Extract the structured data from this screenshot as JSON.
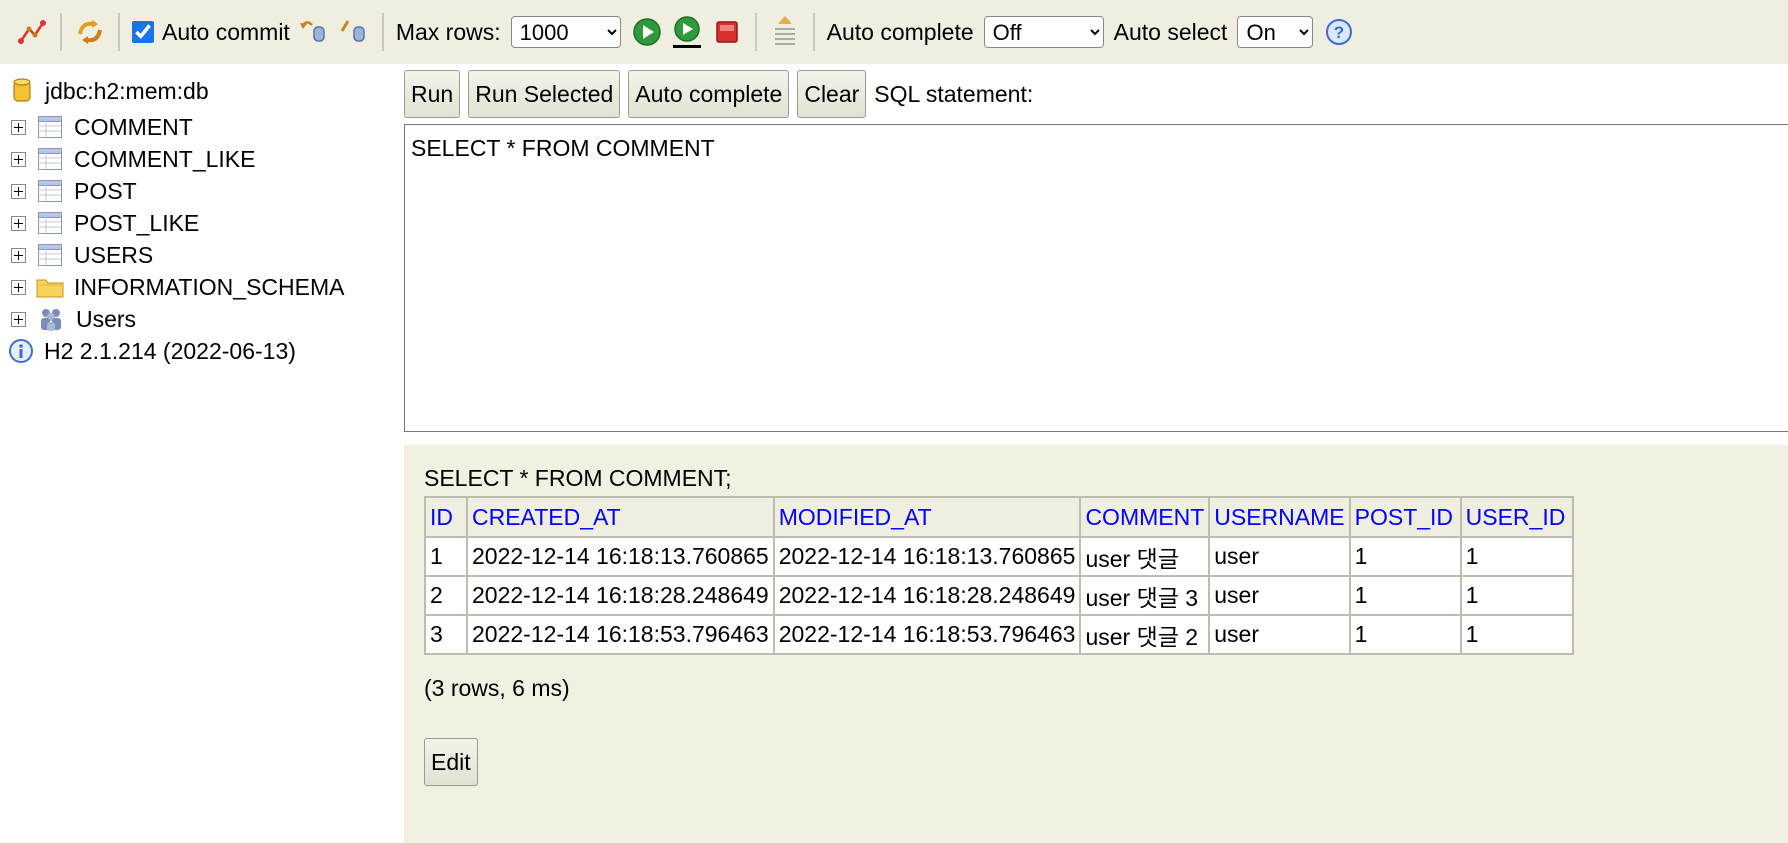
{
  "toolbar": {
    "auto_commit_label": "Auto commit",
    "max_rows_label": "Max rows:",
    "max_rows_value": "1000",
    "auto_complete_label": "Auto complete",
    "auto_complete_value": "Off",
    "auto_select_label": "Auto select",
    "auto_select_value": "On"
  },
  "tree": {
    "connection": "jdbc:h2:mem:db",
    "tables": [
      "COMMENT",
      "COMMENT_LIKE",
      "POST",
      "POST_LIKE",
      "USERS"
    ],
    "schema": "INFORMATION_SCHEMA",
    "users": "Users",
    "version": "H2 2.1.214 (2022-06-13)"
  },
  "buttons": {
    "run": "Run",
    "run_selected": "Run Selected",
    "auto_complete": "Auto complete",
    "clear": "Clear",
    "sql_label": "SQL statement:"
  },
  "editor": {
    "sql": "SELECT * FROM COMMENT"
  },
  "result": {
    "title": "SELECT * FROM COMMENT;",
    "columns": [
      "ID",
      "CREATED_AT",
      "MODIFIED_AT",
      "COMMENT",
      "USERNAME",
      "POST_ID",
      "USER_ID"
    ],
    "rows": [
      [
        "1",
        "2022-12-14 16:18:13.760865",
        "2022-12-14 16:18:13.760865",
        "user 댓글",
        "user",
        "1",
        "1"
      ],
      [
        "2",
        "2022-12-14 16:18:28.248649",
        "2022-12-14 16:18:28.248649",
        "user 댓글 3",
        "user",
        "1",
        "1"
      ],
      [
        "3",
        "2022-12-14 16:18:53.796463",
        "2022-12-14 16:18:53.796463",
        "user 댓글 2",
        "user",
        "1",
        "1"
      ]
    ],
    "summary": "(3 rows, 6 ms)",
    "edit_label": "Edit"
  },
  "colors": {
    "toolbar_bg": "#efeee0",
    "result_bg": "#f1f0e1",
    "header_link": "#0000ff"
  }
}
